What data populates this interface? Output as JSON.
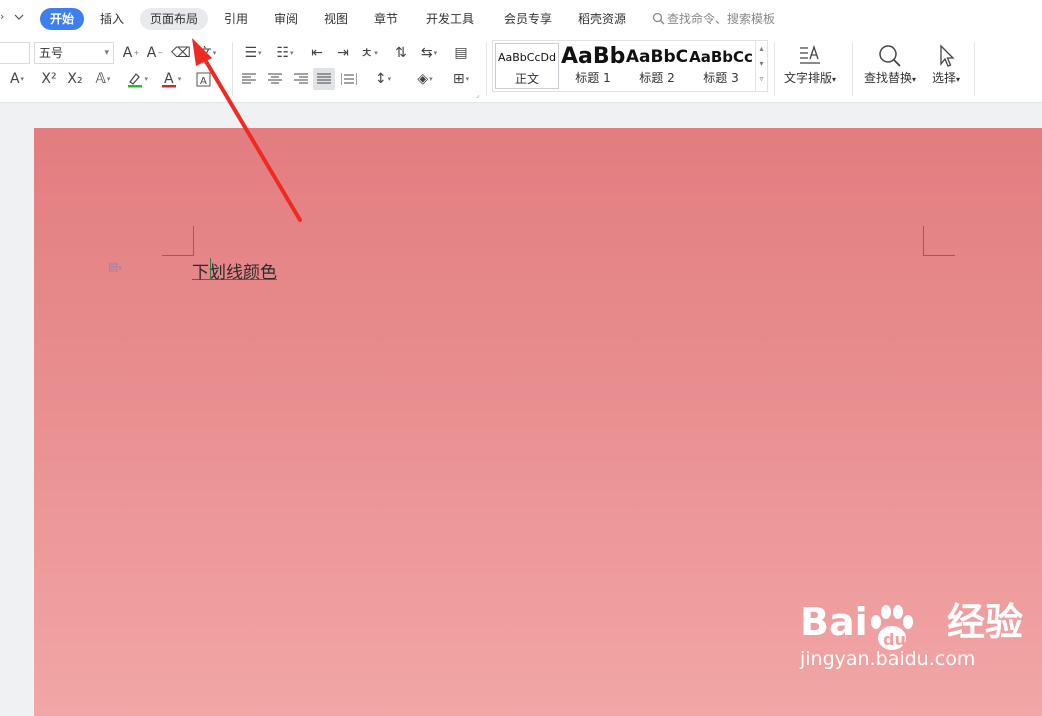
{
  "ribbon": {
    "tabs": [
      {
        "label": "开始",
        "active": true
      },
      {
        "label": "插入"
      },
      {
        "label": "页面布局",
        "highlighted": true
      },
      {
        "label": "引用"
      },
      {
        "label": "审阅"
      },
      {
        "label": "视图"
      },
      {
        "label": "章节"
      },
      {
        "label": "开发工具"
      },
      {
        "label": "会员专享"
      },
      {
        "label": "稻壳资源"
      }
    ],
    "search_text": "查找命令、搜索模板",
    "font_size": "五号",
    "styles": [
      {
        "sample": "AaBbCcDd",
        "name": "正文"
      },
      {
        "sample": "AaBb",
        "name": "标题 1"
      },
      {
        "sample": "AaBbC",
        "name": "标题 2"
      },
      {
        "sample": "AaBbCc",
        "name": "标题 3"
      }
    ],
    "text_layout_label": "文字排版",
    "find_replace_label": "查找替换",
    "select_label": "选择"
  },
  "document": {
    "text": "下划线颜色"
  },
  "annotation": {
    "arrow_color": "#f02a23"
  },
  "watermark": {
    "logo": "Bai      经验",
    "url": "jingyan.baidu.com"
  },
  "colors": {
    "accent": "#3e7ff0",
    "underline": "#d4272b",
    "highlight": "#20c020",
    "font_color": "#d4272b"
  }
}
